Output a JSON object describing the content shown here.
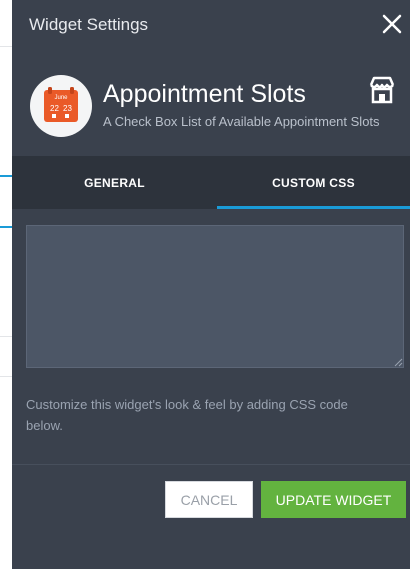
{
  "header": {
    "title": "Widget Settings",
    "close_icon": "close-icon"
  },
  "widget": {
    "name": "Appointment Slots",
    "description": "A Check Box List of Available Appointment Slots",
    "icon": "calendar-icon",
    "calendar_month": "June",
    "calendar_days": [
      "22",
      "23"
    ],
    "store_icon": "store-icon"
  },
  "tabs": [
    {
      "label": "GENERAL",
      "active": false
    },
    {
      "label": "CUSTOM CSS",
      "active": true
    }
  ],
  "editor": {
    "value": ""
  },
  "help_text": "Customize this widget's look & feel by adding CSS code below.",
  "buttons": {
    "cancel": "CANCEL",
    "update": "UPDATE WIDGET"
  },
  "colors": {
    "panel_bg": "#3a414d",
    "tabbar_bg": "#2d333c",
    "active_tab_underline": "#1a9bd7",
    "calendar_orange": "#ea5a28",
    "update_green": "#63b33f"
  }
}
